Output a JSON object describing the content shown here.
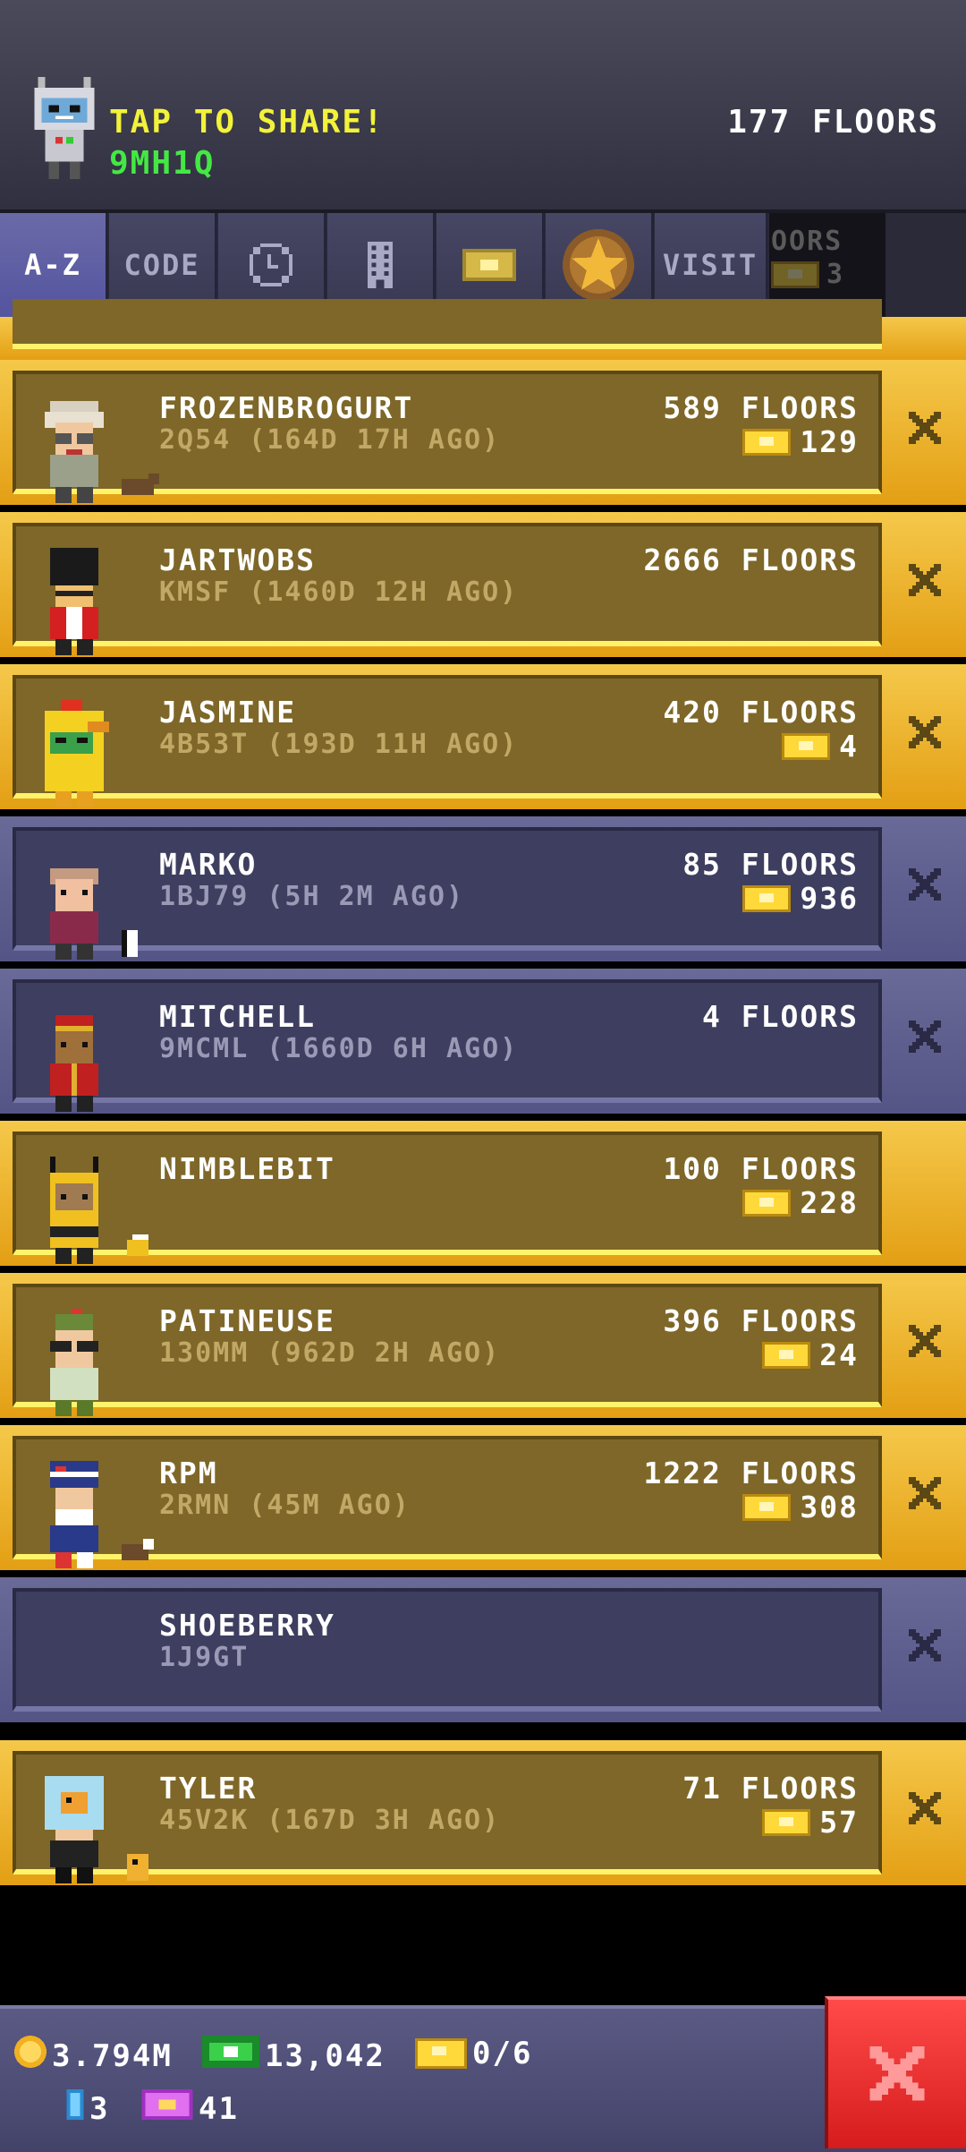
{
  "header": {
    "share_label": "TAP TO SHARE!",
    "share_code": "9MH1Q",
    "floors": "177 FLOORS"
  },
  "tabs": [
    {
      "label": "A-Z",
      "active": true
    },
    {
      "label": "CODE",
      "active": false
    },
    {
      "icon": "clock-icon",
      "active": false
    },
    {
      "icon": "building-icon",
      "active": false
    },
    {
      "icon": "ticket-icon",
      "active": false
    },
    {
      "icon": "star-icon",
      "active": false
    },
    {
      "label": "VISIT",
      "active": false
    }
  ],
  "tab_ghost": {
    "label": "OORS",
    "value": "3"
  },
  "friends": [
    {
      "name": "FROZENBROGURT",
      "sub": "2Q54 (164D 17H AGO)",
      "floors": "589 FLOORS",
      "bux": "129",
      "style": "gold",
      "removable": true
    },
    {
      "name": "JARTWOBS",
      "sub": "KMSF (1460D 12H AGO)",
      "floors": "2666 FLOORS",
      "bux": "",
      "style": "gold",
      "removable": true
    },
    {
      "name": "JASMINE",
      "sub": "4B53T (193D 11H AGO)",
      "floors": "420 FLOORS",
      "bux": "4",
      "style": "gold",
      "removable": true
    },
    {
      "name": "MARKO",
      "sub": "1BJ79 (5H 2M AGO)",
      "floors": "85 FLOORS",
      "bux": "936",
      "style": "purple",
      "removable": true
    },
    {
      "name": "MITCHELL",
      "sub": "9MCML (1660D 6H AGO)",
      "floors": "4 FLOORS",
      "bux": "",
      "style": "purple",
      "removable": true
    },
    {
      "name": "NIMBLEBIT",
      "sub": "",
      "floors": "100 FLOORS",
      "bux": "228",
      "style": "gold",
      "removable": false
    },
    {
      "name": "PATINEUSE",
      "sub": "130MM (962D 2H AGO)",
      "floors": "396 FLOORS",
      "bux": "24",
      "style": "gold",
      "removable": true
    },
    {
      "name": "RPM",
      "sub": "2RMN (45M AGO)",
      "floors": "1222 FLOORS",
      "bux": "308",
      "style": "gold",
      "removable": true
    },
    {
      "name": "SHOEBERRY",
      "sub": "1J9GT",
      "floors": "",
      "bux": "",
      "style": "purple",
      "removable": true
    },
    {
      "name": "TYLER",
      "sub": "45V2K (167D 3H AGO)",
      "floors": "71 FLOORS",
      "bux": "57",
      "style": "gold",
      "removable": true
    }
  ],
  "footer": {
    "coins": "3.794M",
    "bux": "13,042",
    "tickets": "0/6",
    "elevator_count": "3",
    "golden_tickets": "41"
  },
  "colors": {
    "gold_row": "#f5c84a",
    "purple_row": "#6a6a98",
    "share_label": "#f2f23a",
    "share_code": "#44e844",
    "close_button": "#e02424"
  }
}
